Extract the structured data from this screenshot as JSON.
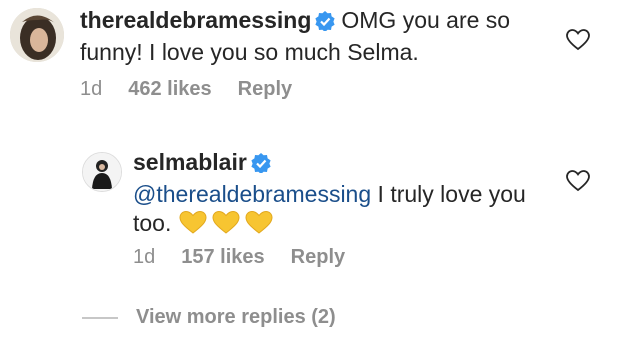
{
  "comments": [
    {
      "username": "therealdebramessing",
      "text": "OMG you are so funny! I love you so much Selma.",
      "time": "1d",
      "likes": "462 likes",
      "reply": "Reply",
      "avatar_icon": "avatar-debra"
    },
    {
      "username": "selmablair",
      "mention": "@therealdebramessing",
      "text": " I truly love you too. ",
      "emoji": "three-yellow-hearts",
      "time": "1d",
      "likes": "157 likes",
      "reply": "Reply",
      "avatar_icon": "avatar-selma"
    }
  ],
  "view_more": "View more replies (2)",
  "colors": {
    "text": "#262626",
    "meta": "#8e8e8e",
    "mention": "#1a4e8a",
    "verified": "#3897f0",
    "heart_emoji": "#f7c531"
  }
}
